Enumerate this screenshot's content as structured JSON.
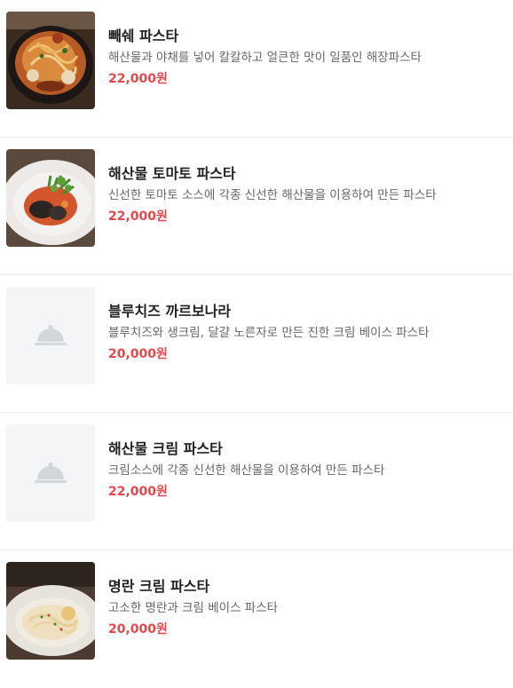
{
  "menu": {
    "items": [
      {
        "name": "빼쉐 파스타",
        "description": "해산물과 야채를 넣어 칼칼하고 얼큰한 맛이 일품인 해장파스타",
        "price": "22,000원",
        "image": "pescatore-pasta-photo"
      },
      {
        "name": "해산물 토마토 파스타",
        "description": "신선한 토마토 소스에 각종 신선한 해산물을 이용하여 만든 파스타",
        "price": "22,000원",
        "image": "seafood-tomato-pasta-photo"
      },
      {
        "name": "블루치즈 까르보나라",
        "description": "블루치즈와 생크림, 달걀 노른자로 만든 진한 크림 베이스 파스타",
        "price": "20,000원",
        "image": "dish-cloche-placeholder-icon"
      },
      {
        "name": "해산물 크림 파스타",
        "description": "크림소스에 각종 신선한 해산물을 이용하여 만든 파스타",
        "price": "22,000원",
        "image": "dish-cloche-placeholder-icon"
      },
      {
        "name": "명란 크림 파스타",
        "description": "고소한 명란과 크림 베이스 파스타",
        "price": "20,000원",
        "image": "mentaiko-cream-pasta-photo"
      }
    ]
  },
  "colors": {
    "price": "#e5474b",
    "name": "#222222",
    "description": "#666666",
    "divider": "#ededed",
    "placeholder_bg": "#f4f5f7",
    "placeholder_icon": "#d3d6db"
  }
}
